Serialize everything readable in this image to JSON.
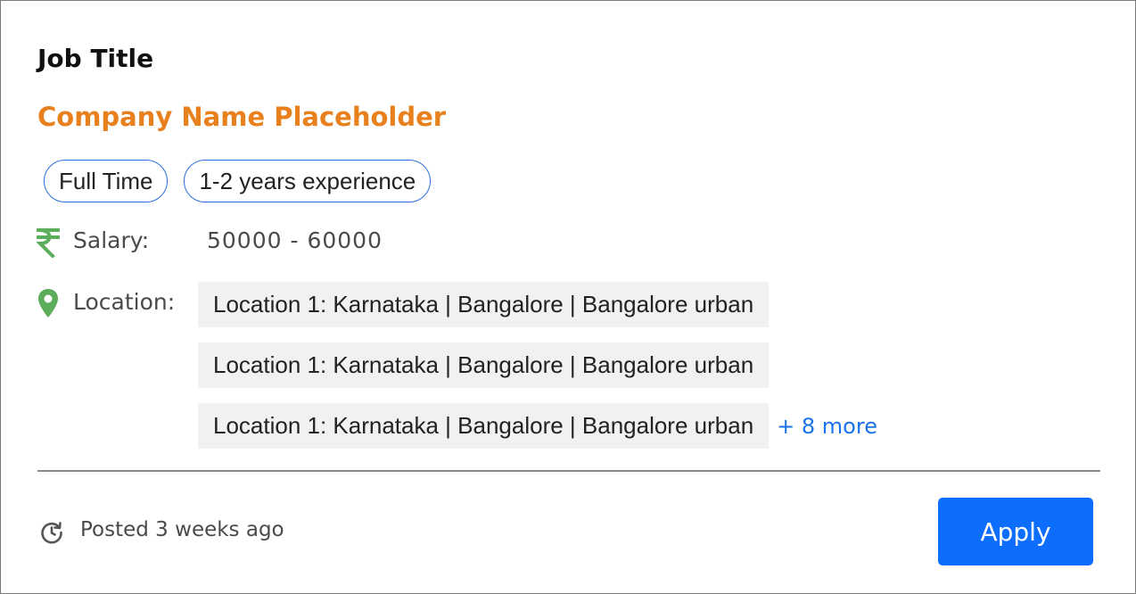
{
  "job": {
    "title": "Job Title",
    "company": "Company Name Placeholder",
    "tags": [
      "Full Time",
      "1-2 years experience"
    ]
  },
  "salary": {
    "label": "Salary:",
    "value": "50000 - 60000",
    "icon": "rupee-icon"
  },
  "location": {
    "label": "Location:",
    "icon": "map-pin-icon",
    "items": [
      "Location 1: Karnataka | Bangalore | Bangalore urban",
      "Location 1: Karnataka | Bangalore | Bangalore urban",
      "Location 1: Karnataka | Bangalore | Bangalore urban"
    ],
    "more_label": "+ 8 more"
  },
  "footer": {
    "posted": "Posted 3 weeks ago",
    "posted_icon": "clock-refresh-icon",
    "apply_label": "Apply"
  },
  "colors": {
    "company": "#e8801d",
    "icon_green": "#5cae5c",
    "link_blue": "#1a73e8",
    "apply_bg": "#0d6efd"
  }
}
